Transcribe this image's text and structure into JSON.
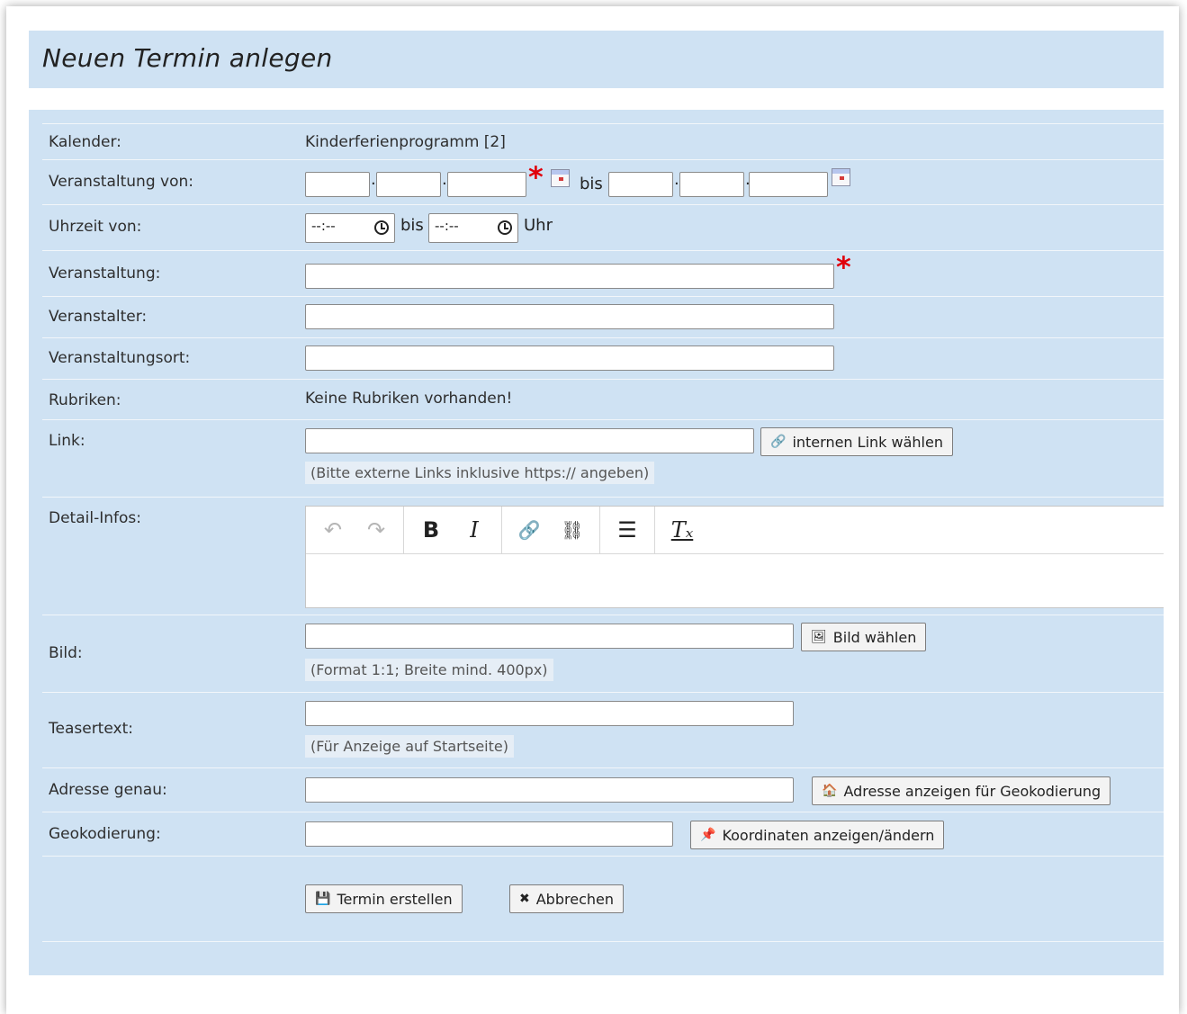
{
  "page": {
    "title": "Neuen Termin anlegen"
  },
  "form": {
    "kalender": {
      "label": "Kalender:",
      "value": "Kinderferienprogramm [2]"
    },
    "veranstaltung_von": {
      "label": "Veranstaltung von:",
      "bis": "bis",
      "separator": "."
    },
    "uhrzeit_von": {
      "label": "Uhrzeit von:",
      "from_value": "--:--",
      "bis": "bis",
      "to_value": "--:--",
      "suffix": "Uhr"
    },
    "veranstaltung": {
      "label": "Veranstaltung:",
      "value": ""
    },
    "veranstalter": {
      "label": "Veranstalter:",
      "value": ""
    },
    "veranstaltungsort": {
      "label": "Veranstaltungsort:",
      "value": ""
    },
    "rubriken": {
      "label": "Rubriken:",
      "value": "Keine Rubriken vorhanden!"
    },
    "link": {
      "label": "Link:",
      "value": "",
      "button": "internen Link wählen",
      "hint": "(Bitte externe Links inklusive https:// angeben)"
    },
    "detail_infos": {
      "label": "Detail-Infos:",
      "toolbar": {
        "undo": "↶",
        "redo": "↷",
        "bold": "B",
        "italic": "I",
        "link": "🔗",
        "unlink": "⛓",
        "list": "☰",
        "clear_format": "Tₓ"
      }
    },
    "bild": {
      "label": "Bild:",
      "value": "",
      "button": "Bild wählen",
      "hint": "(Format 1:1; Breite mind. 400px)"
    },
    "teasertext": {
      "label": "Teasertext:",
      "value": "",
      "hint": "(Für Anzeige auf Startseite)"
    },
    "adresse_genau": {
      "label": "Adresse genau:",
      "value": "",
      "button": "Adresse anzeigen für Geokodierung"
    },
    "geokodierung": {
      "label": "Geokodierung:",
      "value": "",
      "button": "Koordinaten anzeigen/ändern"
    },
    "required_mark": "*"
  },
  "actions": {
    "submit": "Termin erstellen",
    "cancel": "Abbrechen"
  },
  "icons": {
    "link": "🔗",
    "image": "🖼",
    "home": "🏠",
    "pin": "📌",
    "save": "💾",
    "close": "✖"
  },
  "colors": {
    "panel_bg": "#cfe2f3",
    "required": "#e0000b"
  }
}
